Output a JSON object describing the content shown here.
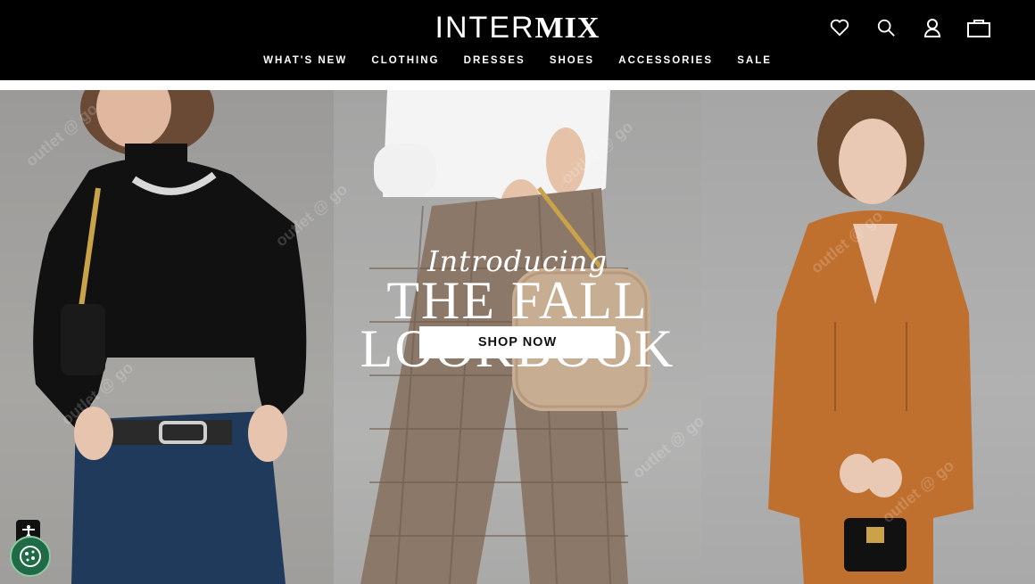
{
  "brand": {
    "logo_left": "INTER",
    "logo_right": "MIX"
  },
  "nav": {
    "items": [
      "WHAT'S NEW",
      "CLOTHING",
      "DRESSES",
      "SHOES",
      "ACCESSORIES",
      "SALE"
    ]
  },
  "header_icons": [
    "heart-icon",
    "search-icon",
    "account-icon",
    "shopping-bag-icon"
  ],
  "hero": {
    "intro": "Introducing",
    "headline_line1": "THE FALL",
    "headline_line2": "LOOKBOOK",
    "cta_label": "SHOP NOW",
    "watermark": "outlet @ go"
  },
  "widgets": {
    "accessibility_icon": "accessibility-icon",
    "cookie_icon": "cookie-icon"
  }
}
